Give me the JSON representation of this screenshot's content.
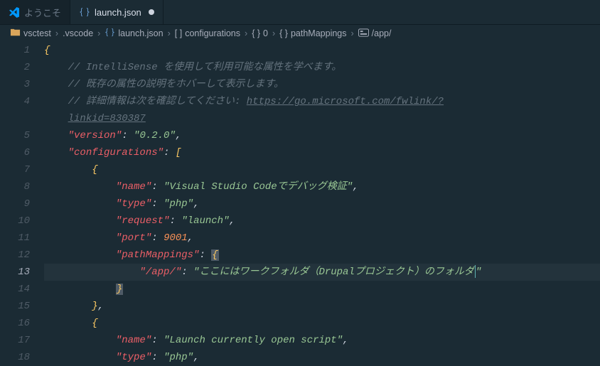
{
  "tabs": {
    "welcome": {
      "label": "ようこそ"
    },
    "file": {
      "label": "launch.json"
    }
  },
  "breadcrumb": {
    "p0": "vsctest",
    "p1": ".vscode",
    "p2": "launch.json",
    "p3": "configurations",
    "p4": "0",
    "p5": "pathMappings",
    "p6": "/app/"
  },
  "lines": {
    "l2": "// IntelliSense を使用して利用可能な属性を学べます。",
    "l3": "// 既存の属性の説明をホバーして表示します。",
    "l4a": "// 詳細情報は次を確認してください: ",
    "l4b": "https://go.microsoft.com/fwlink/?",
    "l4c": "linkid=830387"
  },
  "keys": {
    "version": "\"version\"",
    "configurations": "\"configurations\"",
    "name": "\"name\"",
    "type": "\"type\"",
    "request": "\"request\"",
    "port": "\"port\"",
    "pathMappings": "\"pathMappings\"",
    "app": "\"/app/\""
  },
  "vals": {
    "version": "\"0.2.0\"",
    "name1": "\"Visual Studio Codeでデバッグ検証\"",
    "type": "\"php\"",
    "request": "\"launch\"",
    "port": "9001",
    "app_val_open": "\"ここにはワークフォルダ（Drupalプロジェクト）のフォルダ",
    "name2": "\"Launch currently open script\""
  },
  "gutter": {
    "n1": "1",
    "n2": "2",
    "n3": "3",
    "n4": "4",
    "n5": "5",
    "n6": "6",
    "n7": "7",
    "n8": "8",
    "n9": "9",
    "n10": "10",
    "n11": "11",
    "n12": "12",
    "n13": "13",
    "n14": "14",
    "n15": "15",
    "n16": "16",
    "n17": "17",
    "n18": "18"
  }
}
